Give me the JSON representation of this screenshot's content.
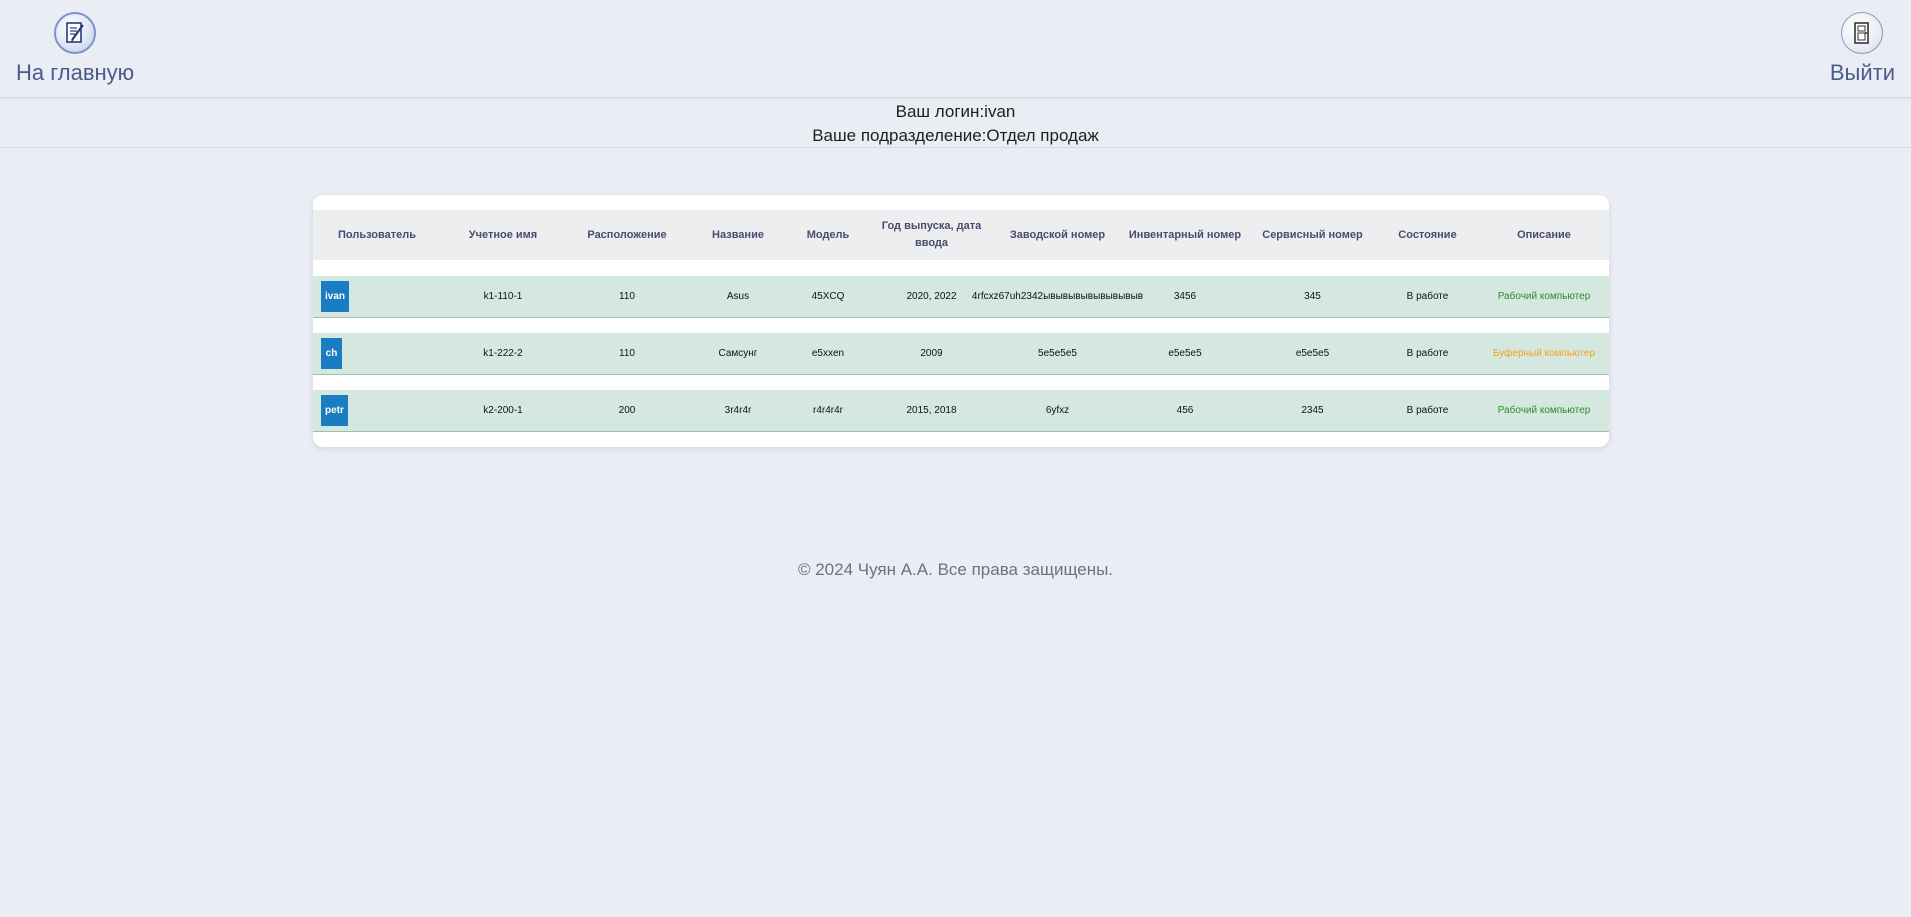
{
  "nav": {
    "home_label": "На главную",
    "home_icon": "edit-document-icon",
    "exit_label": "Выйти",
    "exit_icon": "door-exit-icon"
  },
  "userinfo": {
    "login_text": "Ваш логин:ivan",
    "department_text": "Ваше подразделение:Отдел продаж"
  },
  "table": {
    "headers": [
      "Пользователь",
      "Учетное имя",
      "Расположение",
      "Название",
      "Модель",
      "Год выпуска, дата ввода",
      "Заводской номер",
      "Инвентарный номер",
      "Сервисный номер",
      "Состояние",
      "Описание"
    ],
    "rows": [
      {
        "user": "ivan",
        "account": "k1-110-1",
        "location": "110",
        "name": "Asus",
        "model": "45XCQ",
        "year": "2020, 2022",
        "serial": "4rfcxz67uh2342ывывывывывывывыв",
        "inventory": "3456",
        "service": "345",
        "status": "В работе",
        "description": "Рабочий компьютер"
      },
      {
        "user": "ch",
        "account": "k1-222-2",
        "location": "110",
        "name": "Самсунг",
        "model": "e5xxen",
        "year": "2009",
        "serial": "5e5e5e5",
        "inventory": "e5e5e5",
        "service": "e5e5e5",
        "status": "В работе",
        "description": "Буферный компьютер"
      },
      {
        "user": "petr",
        "account": "k2-200-1",
        "location": "200",
        "name": "3r4r4r",
        "model": "r4r4r4r",
        "year": "2015, 2018",
        "serial": "6yfxz",
        "inventory": "456",
        "service": "2345",
        "status": "В работе",
        "description": "Рабочий компьютер"
      }
    ]
  },
  "colors": {
    "badge": "#1a7dc2",
    "row_bg": "#d4e8df",
    "working_desc": "#2e8b2e",
    "buffer_desc": "#f5a01f"
  },
  "footer": {
    "text": "© 2024 Чуян А.А. Все права защищены."
  }
}
